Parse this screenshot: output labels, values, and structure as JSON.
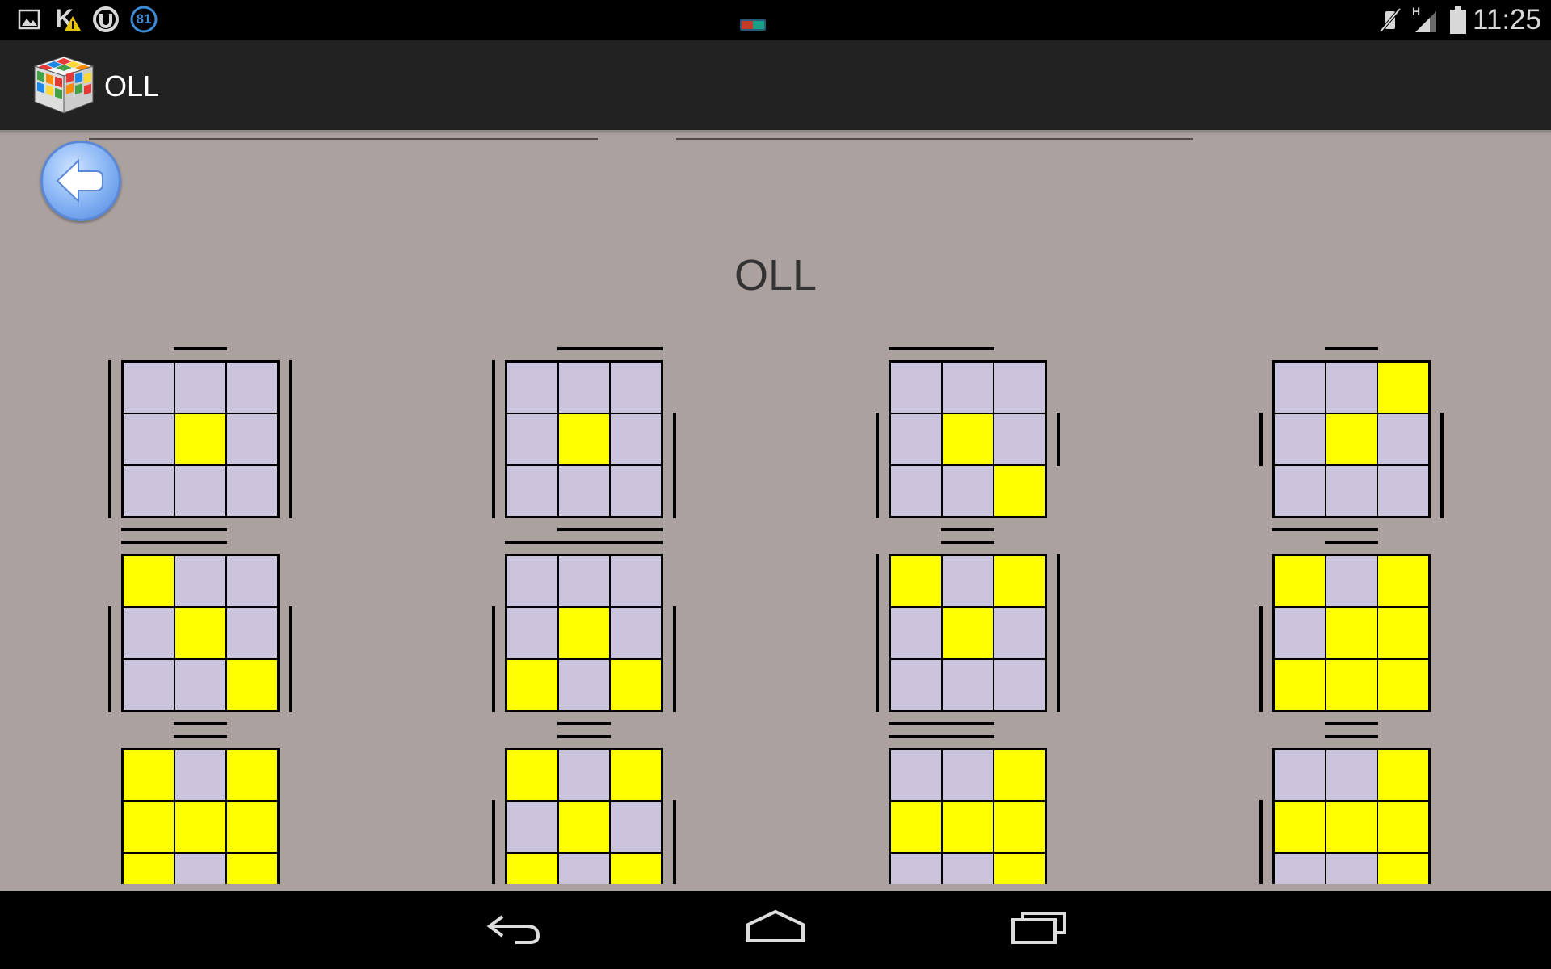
{
  "status_bar": {
    "notification_badge": "81",
    "time": "11:25",
    "network_type": "H"
  },
  "action_bar": {
    "title": "OLL"
  },
  "page": {
    "heading": "OLL"
  },
  "colors": {
    "yellow": "#ffff00",
    "gray_sticker": "#cbc3db",
    "background": "#aba19e",
    "action_bar": "#222222"
  },
  "oll_cases": [
    {
      "grid": "000010000",
      "top": "1",
      "bottom": "11",
      "left": "3",
      "right": "3"
    },
    {
      "grid": "000010000",
      "top": "011",
      "bottom": "011",
      "left": "3",
      "right": "2"
    },
    {
      "grid": "000010001",
      "top": "110",
      "bottom": "1",
      "left": "2",
      "right": "1"
    },
    {
      "grid": "001010000",
      "top": "1",
      "bottom": "11",
      "left": "1",
      "right": "2"
    },
    {
      "grid": "100010001",
      "top": "11",
      "bottom": "1",
      "left": "2",
      "right": "2"
    },
    {
      "grid": "000010101",
      "top": "111",
      "bottom": "1",
      "left": "2",
      "right": "2"
    },
    {
      "grid": "101010000",
      "top": "1",
      "bottom": "11",
      "left": "3",
      "right": "3"
    },
    {
      "grid": "101011111",
      "top": "1",
      "bottom": "1",
      "left": "2",
      "right": "0"
    },
    {
      "grid": "101111101",
      "top": "1",
      "bottom": "0",
      "left": "0",
      "right": "0"
    },
    {
      "grid": "101010101",
      "top": "1",
      "bottom": "0",
      "left": "2",
      "right": "2"
    },
    {
      "grid": "001111001",
      "top": "110",
      "bottom": "0",
      "left": "0",
      "right": "0"
    },
    {
      "grid": "001111001",
      "top": "1",
      "bottom": "0",
      "left": "2",
      "right": "0"
    }
  ]
}
